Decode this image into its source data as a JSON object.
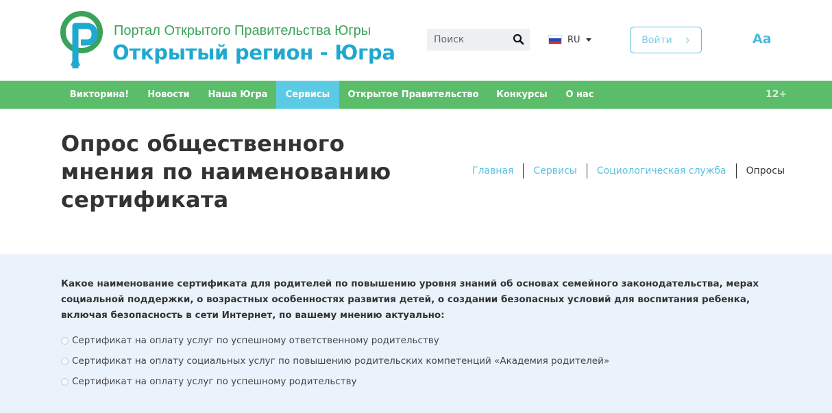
{
  "header": {
    "brand_small": "Портал Открытого Правительства Югры",
    "brand_big": "Открытый регион - Югра",
    "search_placeholder": "Поиск",
    "language": "RU",
    "login_label": "Войти",
    "font_size_label": "Aa"
  },
  "nav": {
    "items": [
      {
        "label": "Викторина!"
      },
      {
        "label": "Новости"
      },
      {
        "label": "Наша Югра"
      },
      {
        "label": "Сервисы",
        "active": true
      },
      {
        "label": "Открытое Правительство"
      },
      {
        "label": "Конкурсы"
      },
      {
        "label": "О нас"
      }
    ],
    "age_rating": "12+"
  },
  "page": {
    "title": "Опрос общественного мнения по наименованию сертификата",
    "breadcrumb": [
      "Главная",
      "Сервисы",
      "Социологическая служба",
      "Опросы"
    ]
  },
  "survey": {
    "question": "Какое наименование сертификата для родителей по повышению уровня знаний об основах семейного законодательства, мерах социальной поддержки, о возрастных особенностях развития детей, о создании безопасных условий для воспитания ребенка, включая безопасность в сети Интернет, по вашему мнению актуально:",
    "options": [
      "Сертификат на оплату услуг по успешному ответственному родительству",
      "Сертификат на оплату социальных услуг по повышению родительских компетенций «Академия родителей»",
      "Сертификат на оплату услуг по успешному родительству"
    ]
  },
  "colors": {
    "nav_bg": "#5bbd6a",
    "nav_active": "#5bcbe5",
    "brand_green": "#3aa35a",
    "brand_blue": "#1fa9cf",
    "link": "#5bc2e0",
    "survey_bg": "#eaf3fc"
  },
  "icons": {
    "logo": "portal-logo-icon",
    "search": "search-icon",
    "flag": "russia-flag-icon",
    "dropdown": "caret-down-icon",
    "login_arrow": "chevron-right-icon"
  }
}
